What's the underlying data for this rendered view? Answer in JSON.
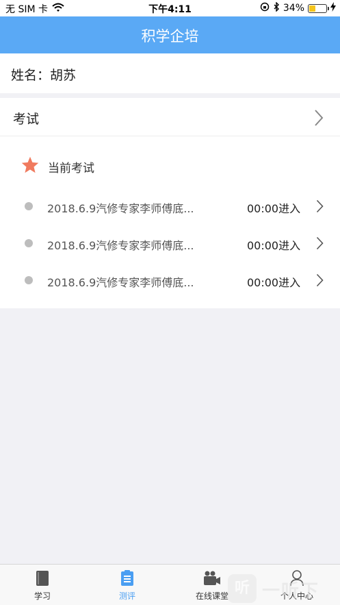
{
  "status_bar": {
    "carrier": "无 SIM 卡",
    "time": "下午4:11",
    "battery": "34%",
    "battery_level": 0.34
  },
  "nav": {
    "title": "积学企培"
  },
  "profile": {
    "name_line": "姓名：胡苏"
  },
  "exam": {
    "header_label": "考试",
    "current_label": "当前考试",
    "items": [
      {
        "title": "2018.6.9汽修专家李师傅底...",
        "time_action": "00:00进入"
      },
      {
        "title": "2018.6.9汽修专家李师傅底...",
        "time_action": "00:00进入"
      },
      {
        "title": "2018.6.9汽修专家李师傅底...",
        "time_action": "00:00进入"
      }
    ]
  },
  "tabs": [
    {
      "label": "学习",
      "icon": "book-icon",
      "active": false
    },
    {
      "label": "测评",
      "icon": "clipboard-icon",
      "active": true
    },
    {
      "label": "在线课堂",
      "icon": "video-camera-icon",
      "active": false
    },
    {
      "label": "个人中心",
      "icon": "person-icon",
      "active": false
    }
  ],
  "watermark": {
    "badge": "听",
    "text": "一听下载"
  },
  "colors": {
    "nav_bg": "#5aa9f5",
    "tab_active": "#4a9ef2",
    "star": "#f07a5e",
    "page_bg": "#f1f1f5"
  }
}
